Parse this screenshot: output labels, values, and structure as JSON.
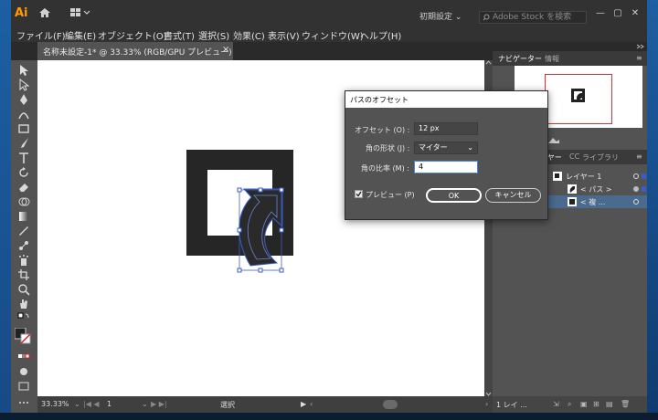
{
  "app": {
    "logo": "Ai",
    "workspace_preset": "初期設定 ⌄",
    "stock_search_placeholder": "Adobe Stock を検索",
    "window_controls": [
      "—",
      "▢",
      "✕"
    ]
  },
  "menu": [
    "ファイル(F)",
    "編集(E)",
    "オブジェクト(O)",
    "書式(T)",
    "選択(S)",
    "効果(C)",
    "表示(V)",
    "ウィンドウ(W)",
    "ヘルプ(H)"
  ],
  "document_tab": {
    "title": "名称未設定-1* @ 33.33% (RGB/GPU プレビュー)",
    "close": "×"
  },
  "tools": [
    "selection-tool",
    "direct-selection-tool",
    "pen-tool",
    "curvature-tool",
    "rectangle-tool",
    "paintbrush-tool",
    "type-tool",
    "rotate-tool",
    "eraser-tool",
    "shape-builder-tool",
    "gradient-tool",
    "eyedropper-tool",
    "blend-tool",
    "symbol-sprayer-tool",
    "artboard-tool",
    "slice-tool",
    "zoom-tool",
    "hand-tool"
  ],
  "status": {
    "zoom": "33.33%",
    "artboard_number": "1",
    "mode": "選択"
  },
  "navigator": {
    "tabs": [
      "ナビゲーター",
      "情報"
    ],
    "zoom_suffix": "%"
  },
  "layers": {
    "tabs": [
      "レイヤー",
      "ライブラリ"
    ],
    "rows": [
      {
        "label": "レイヤー 1"
      },
      {
        "label": "< パス >"
      },
      {
        "label": "< 複 ..."
      }
    ],
    "footer": "1 レイ ..."
  },
  "dialog": {
    "title": "パスのオフセット",
    "offset_label": "オフセット (O) :",
    "offset_value": "12 px",
    "joins_label": "角の形状 (J) :",
    "joins_value": "マイター",
    "miter_label": "角の比率 (M) :",
    "miter_value": "4",
    "preview_label": "プレビュー (P)",
    "preview_checked": true,
    "ok_label": "OK",
    "cancel_label": "キャンセル"
  },
  "colors": {
    "ui_bg": "#535353",
    "ui_dark": "#323232",
    "accent": "#4a6a8e",
    "selection": "#3a5cc8",
    "logo": "#ff9a00"
  }
}
